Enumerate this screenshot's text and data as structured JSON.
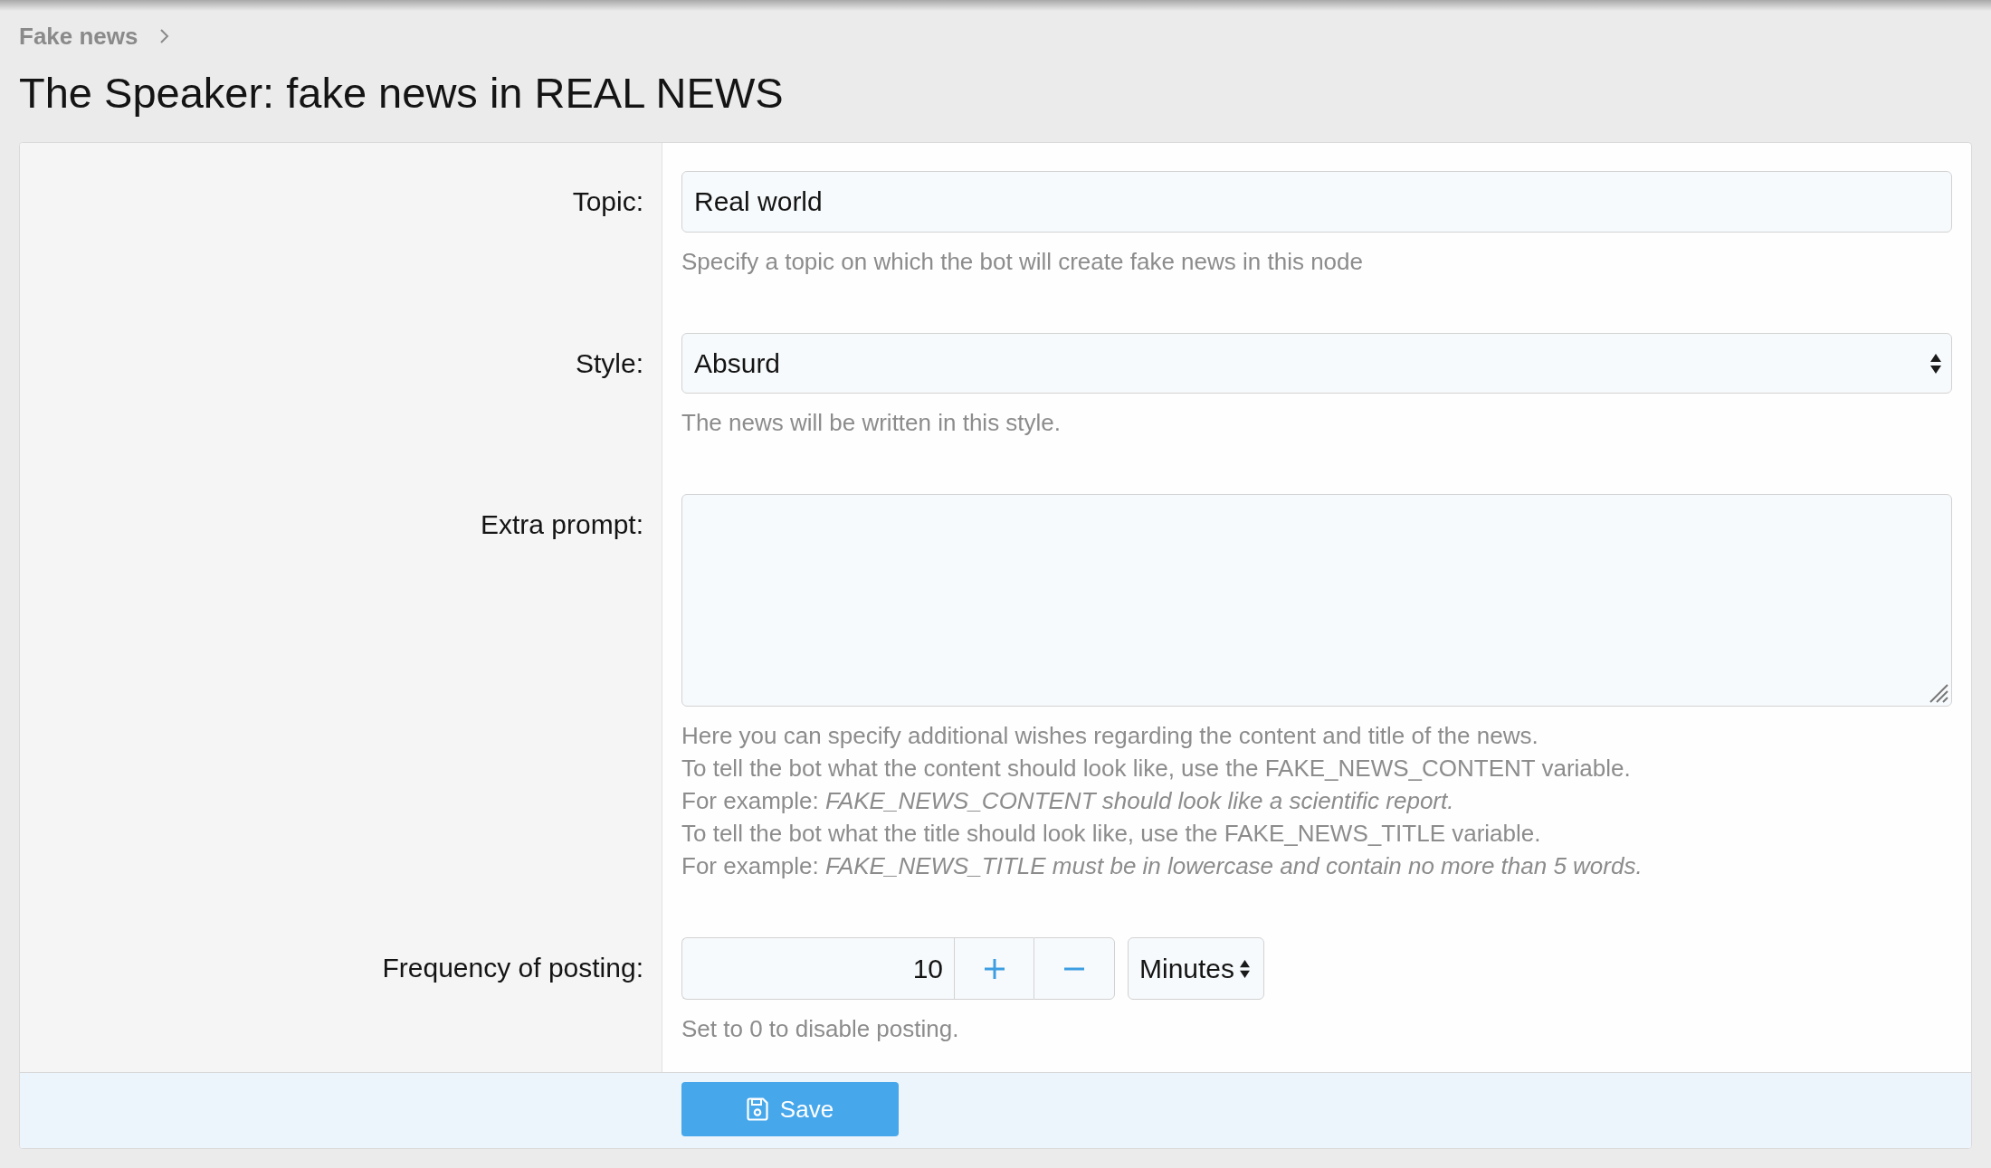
{
  "breadcrumb": [
    {
      "label": "Fake news"
    }
  ],
  "title": "The Speaker: fake news in REAL NEWS",
  "form": {
    "rows": [
      {
        "kind": "text",
        "label": "Topic:",
        "value": "Real world",
        "help": [
          "Specify a topic on which the bot will create fake news in this node"
        ]
      },
      {
        "kind": "select",
        "label": "Style:",
        "value": "Absurd",
        "help": [
          "The news will be written in this style."
        ]
      },
      {
        "kind": "textarea",
        "label": "Extra prompt:",
        "help": [
          "Here you can specify additional wishes regarding the content and title of the news.",
          "To tell the bot what the content should look like, use the FAKE_NEWS_CONTENT variable.",
          "For example: *FAKE_NEWS_CONTENT should look like a scientific report.*",
          "To tell the bot what the title should look like, use the FAKE_NEWS_TITLE variable.",
          "For example: *FAKE_NEWS_TITLE must be in lowercase and contain no more than 5 words.*"
        ]
      },
      {
        "kind": "number",
        "label": "Frequency of posting:",
        "value": "10",
        "unit": "Minutes",
        "help": [
          "Set to 0 to disable posting."
        ]
      }
    ]
  },
  "save_button": {
    "label": "Save"
  }
}
